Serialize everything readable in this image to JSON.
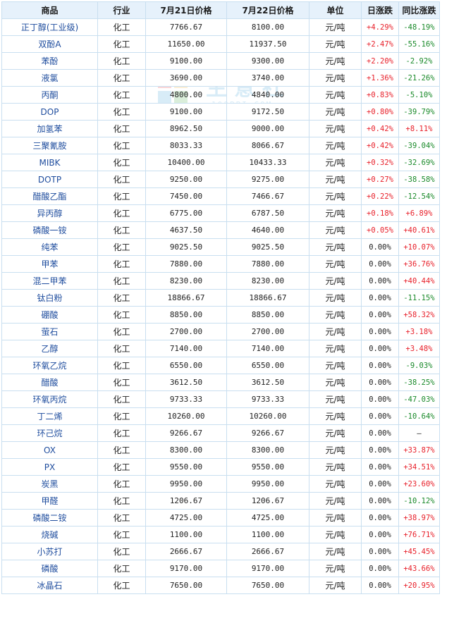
{
  "watermark": {
    "text": "生意社",
    "url": "100PPI.COM"
  },
  "headers": [
    "商品",
    "行业",
    "7月21日价格",
    "7月22日价格",
    "单位",
    "日涨跌",
    "同比涨跌"
  ],
  "colors": {
    "up": "#e8202a",
    "down": "#1a8a2a",
    "header_bg": "#e6f1fb",
    "border": "#c9dff0",
    "name": "#1f4d9e"
  },
  "rows": [
    {
      "name": "正丁醇(工业级)",
      "industry": "化工",
      "p1": "7766.67",
      "p2": "8100.00",
      "unit": "元/吨",
      "day": "+4.29%",
      "yoy": "-48.19%"
    },
    {
      "name": "双酚A",
      "industry": "化工",
      "p1": "11650.00",
      "p2": "11937.50",
      "unit": "元/吨",
      "day": "+2.47%",
      "yoy": "-55.16%"
    },
    {
      "name": "苯酚",
      "industry": "化工",
      "p1": "9100.00",
      "p2": "9300.00",
      "unit": "元/吨",
      "day": "+2.20%",
      "yoy": "-2.92%"
    },
    {
      "name": "液氯",
      "industry": "化工",
      "p1": "3690.00",
      "p2": "3740.00",
      "unit": "元/吨",
      "day": "+1.36%",
      "yoy": "-21.26%"
    },
    {
      "name": "丙酮",
      "industry": "化工",
      "p1": "4800.00",
      "p2": "4840.00",
      "unit": "元/吨",
      "day": "+0.83%",
      "yoy": "-5.10%"
    },
    {
      "name": "DOP",
      "industry": "化工",
      "p1": "9100.00",
      "p2": "9172.50",
      "unit": "元/吨",
      "day": "+0.80%",
      "yoy": "-39.79%"
    },
    {
      "name": "加氢苯",
      "industry": "化工",
      "p1": "8962.50",
      "p2": "9000.00",
      "unit": "元/吨",
      "day": "+0.42%",
      "yoy": "+8.11%"
    },
    {
      "name": "三聚氰胺",
      "industry": "化工",
      "p1": "8033.33",
      "p2": "8066.67",
      "unit": "元/吨",
      "day": "+0.42%",
      "yoy": "-39.04%"
    },
    {
      "name": "MIBK",
      "industry": "化工",
      "p1": "10400.00",
      "p2": "10433.33",
      "unit": "元/吨",
      "day": "+0.32%",
      "yoy": "-32.69%"
    },
    {
      "name": "DOTP",
      "industry": "化工",
      "p1": "9250.00",
      "p2": "9275.00",
      "unit": "元/吨",
      "day": "+0.27%",
      "yoy": "-38.58%"
    },
    {
      "name": "醋酸乙酯",
      "industry": "化工",
      "p1": "7450.00",
      "p2": "7466.67",
      "unit": "元/吨",
      "day": "+0.22%",
      "yoy": "-12.54%"
    },
    {
      "name": "异丙醇",
      "industry": "化工",
      "p1": "6775.00",
      "p2": "6787.50",
      "unit": "元/吨",
      "day": "+0.18%",
      "yoy": "+6.89%"
    },
    {
      "name": "磷酸一铵",
      "industry": "化工",
      "p1": "4637.50",
      "p2": "4640.00",
      "unit": "元/吨",
      "day": "+0.05%",
      "yoy": "+40.61%"
    },
    {
      "name": "纯苯",
      "industry": "化工",
      "p1": "9025.50",
      "p2": "9025.50",
      "unit": "元/吨",
      "day": "0.00%",
      "yoy": "+10.07%"
    },
    {
      "name": "甲苯",
      "industry": "化工",
      "p1": "7880.00",
      "p2": "7880.00",
      "unit": "元/吨",
      "day": "0.00%",
      "yoy": "+36.76%"
    },
    {
      "name": "混二甲苯",
      "industry": "化工",
      "p1": "8230.00",
      "p2": "8230.00",
      "unit": "元/吨",
      "day": "0.00%",
      "yoy": "+40.44%"
    },
    {
      "name": "钛白粉",
      "industry": "化工",
      "p1": "18866.67",
      "p2": "18866.67",
      "unit": "元/吨",
      "day": "0.00%",
      "yoy": "-11.15%"
    },
    {
      "name": "硼酸",
      "industry": "化工",
      "p1": "8850.00",
      "p2": "8850.00",
      "unit": "元/吨",
      "day": "0.00%",
      "yoy": "+58.32%"
    },
    {
      "name": "萤石",
      "industry": "化工",
      "p1": "2700.00",
      "p2": "2700.00",
      "unit": "元/吨",
      "day": "0.00%",
      "yoy": "+3.18%"
    },
    {
      "name": "乙醇",
      "industry": "化工",
      "p1": "7140.00",
      "p2": "7140.00",
      "unit": "元/吨",
      "day": "0.00%",
      "yoy": "+3.48%"
    },
    {
      "name": "环氧乙烷",
      "industry": "化工",
      "p1": "6550.00",
      "p2": "6550.00",
      "unit": "元/吨",
      "day": "0.00%",
      "yoy": "-9.03%"
    },
    {
      "name": "醋酸",
      "industry": "化工",
      "p1": "3612.50",
      "p2": "3612.50",
      "unit": "元/吨",
      "day": "0.00%",
      "yoy": "-38.25%"
    },
    {
      "name": "环氧丙烷",
      "industry": "化工",
      "p1": "9733.33",
      "p2": "9733.33",
      "unit": "元/吨",
      "day": "0.00%",
      "yoy": "-47.03%"
    },
    {
      "name": "丁二烯",
      "industry": "化工",
      "p1": "10260.00",
      "p2": "10260.00",
      "unit": "元/吨",
      "day": "0.00%",
      "yoy": "-10.64%"
    },
    {
      "name": "环己烷",
      "industry": "化工",
      "p1": "9266.67",
      "p2": "9266.67",
      "unit": "元/吨",
      "day": "0.00%",
      "yoy": "—"
    },
    {
      "name": "OX",
      "industry": "化工",
      "p1": "8300.00",
      "p2": "8300.00",
      "unit": "元/吨",
      "day": "0.00%",
      "yoy": "+33.87%"
    },
    {
      "name": "PX",
      "industry": "化工",
      "p1": "9550.00",
      "p2": "9550.00",
      "unit": "元/吨",
      "day": "0.00%",
      "yoy": "+34.51%"
    },
    {
      "name": "炭黑",
      "industry": "化工",
      "p1": "9950.00",
      "p2": "9950.00",
      "unit": "元/吨",
      "day": "0.00%",
      "yoy": "+23.60%"
    },
    {
      "name": "甲醛",
      "industry": "化工",
      "p1": "1206.67",
      "p2": "1206.67",
      "unit": "元/吨",
      "day": "0.00%",
      "yoy": "-10.12%"
    },
    {
      "name": "磷酸二铵",
      "industry": "化工",
      "p1": "4725.00",
      "p2": "4725.00",
      "unit": "元/吨",
      "day": "0.00%",
      "yoy": "+38.97%"
    },
    {
      "name": "烧碱",
      "industry": "化工",
      "p1": "1100.00",
      "p2": "1100.00",
      "unit": "元/吨",
      "day": "0.00%",
      "yoy": "+76.71%"
    },
    {
      "name": "小苏打",
      "industry": "化工",
      "p1": "2666.67",
      "p2": "2666.67",
      "unit": "元/吨",
      "day": "0.00%",
      "yoy": "+45.45%"
    },
    {
      "name": "磷酸",
      "industry": "化工",
      "p1": "9170.00",
      "p2": "9170.00",
      "unit": "元/吨",
      "day": "0.00%",
      "yoy": "+43.66%"
    },
    {
      "name": "冰晶石",
      "industry": "化工",
      "p1": "7650.00",
      "p2": "7650.00",
      "unit": "元/吨",
      "day": "0.00%",
      "yoy": "+20.95%"
    }
  ]
}
